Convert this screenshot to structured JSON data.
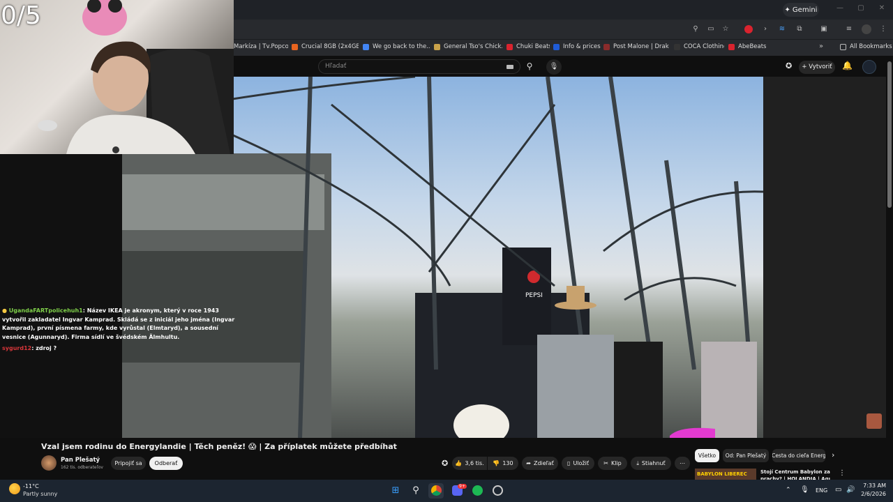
{
  "overlay": {
    "counter": "0/5"
  },
  "browser": {
    "gemini_label": "Gemini",
    "bookmarks": [
      {
        "label": "Markíza | Tv.Popcor...",
        "color": "#888888"
      },
      {
        "label": "Crucial 8GB (2x4GB)...",
        "color": "#e8641f"
      },
      {
        "label": "We go back to the...",
        "color": "#4285f4"
      },
      {
        "label": "General Tso's Chick...",
        "color": "#c9a24a"
      },
      {
        "label": "Chuki Beats",
        "color": "#d9232e"
      },
      {
        "label": "Info & prices",
        "color": "#1f5bd6"
      },
      {
        "label": "Post Malone | Drake...",
        "color": "#8a2b2b"
      },
      {
        "label": "COCA Clothing",
        "color": "#333333"
      },
      {
        "label": "AbeBeats",
        "color": "#d9232e"
      }
    ],
    "all_bookmarks": "All Bookmarks"
  },
  "youtube": {
    "search_placeholder": "Hľadať",
    "create_label": "Vytvoriť",
    "video_title": "Vzal jsem rodinu do Energylandie | Těch peněz! 😱 | Za příplatek můžete předbíhat",
    "channel_name": "Pan Plešatý",
    "channel_subs": "162 tis. odberateľov",
    "join_label": "Pripojiť sa",
    "unsubscribe_label": "Odberať",
    "likes": "3,6 tis.",
    "dislikes": "130",
    "share_label": "Zdieľať",
    "save_label": "Uložiť",
    "clip_label": "Klip",
    "download_label": "Stiahnuť",
    "chips": [
      "Všetko",
      "Od: Pan Plešatý",
      "Cesta do cieľa Energ"
    ],
    "rec_title": "Stojí Centrum Babylon za ty",
    "rec_sub": "prachy? | HOLANDIA | Aquapa",
    "rec_thumb_text": "BABYLON LIBEREC"
  },
  "chat": [
    {
      "user": "UgandaFARTpolicehuh1",
      "user_color": "#7fd04a",
      "text": ": Název IKEA je akronym, který v roce 1943 vytvořil zakladatel Ingvar Kamprad. Skládá se z iniciál jeho jména (Ingvar Kamprad), první písmena farmy, kde vyrůstal (Elmtaryd), a sousední vesnice (Agunnaryd). Firma sídlí ve švédském Älmhultu."
    },
    {
      "user": "sygurd12",
      "user_color": "#d9363a",
      "text": ": zdroj ?"
    }
  ],
  "video_scene": {
    "sign_text": "PEPSI"
  },
  "taskbar": {
    "temp": "-11°C",
    "weather": "Partly sunny",
    "lang": "ENG",
    "time": "7:33 AM",
    "date": "2/6/2026",
    "discord_badge": "9+"
  }
}
